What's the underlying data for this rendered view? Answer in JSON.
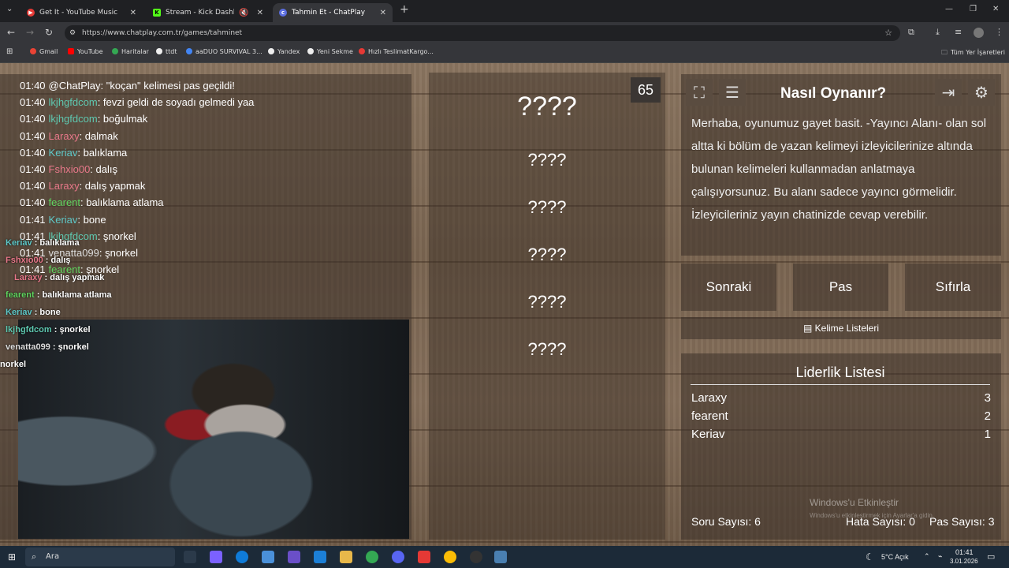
{
  "browser": {
    "tabs": [
      {
        "label": "Get It - YouTube Music",
        "color": "#e53935"
      },
      {
        "label": "Stream - Kick Dashboard",
        "color": "#53fc18"
      },
      {
        "label": "Tahmin Et - ChatPlay",
        "color": "#5b6ee1"
      }
    ],
    "url": "https://www.chatplay.com.tr/games/tahminet",
    "bookmarks": [
      "Gmail",
      "YouTube",
      "Haritalar",
      "ttdt",
      "aaDUO SURVIVAL 3...",
      "Yandex",
      "Yeni Sekme",
      "Hızlı TeslimatKargo..."
    ],
    "all_bookmarks": "Tüm Yer İşaretleri"
  },
  "chat": [
    {
      "time": "01:40",
      "user": "@ChatPlay",
      "msg": ": \"koçan\" kelimesi pas geçildi!",
      "color": "#ffffff"
    },
    {
      "time": "01:40",
      "user": "lkjhgfdcom",
      "msg": ": fevzi geldi de soyadı gelmedi yaa",
      "color": "#5ec8b0"
    },
    {
      "time": "01:40",
      "user": "lkjhgfdcom",
      "msg": ": boğulmak",
      "color": "#5ec8b0"
    },
    {
      "time": "01:40",
      "user": "Laraxy",
      "msg": ": dalmak",
      "color": "#e8788a"
    },
    {
      "time": "01:40",
      "user": "Keriav",
      "msg": ": balıklama",
      "color": "#5ec8c8"
    },
    {
      "time": "01:40",
      "user": "Fshxio00",
      "msg": ": dalış",
      "color": "#e8788a"
    },
    {
      "time": "01:40",
      "user": "Laraxy",
      "msg": ": dalış yapmak",
      "color": "#e8788a"
    },
    {
      "time": "01:40",
      "user": "fearent",
      "msg": ": balıklama atlama",
      "color": "#5fd45f"
    },
    {
      "time": "01:41",
      "user": "Keriav",
      "msg": ": bone",
      "color": "#5ec8c8"
    },
    {
      "time": "01:41",
      "user": "lkjhgfdcom",
      "msg": ": şnorkel",
      "color": "#5ec8b0"
    },
    {
      "time": "01:41",
      "user": "venatta099",
      "msg": ": şnorkel",
      "color": "#dddddd"
    },
    {
      "time": "01:41",
      "user": "fearent",
      "msg": ": şnorkel",
      "color": "#5fd45f"
    }
  ],
  "overlay": [
    {
      "user": "Keriav",
      "msg": " : balıklama",
      "color": "#5ec8c8"
    },
    {
      "user": "Fshxio00",
      "msg": " : dalış",
      "color": "#e8788a"
    },
    {
      "user": "Laraxy",
      "msg": " : dalış yapmak",
      "color": "#e8788a"
    },
    {
      "user": "fearent",
      "msg": " : balıklama atlama",
      "color": "#5fd45f"
    },
    {
      "user": "Keriav",
      "msg": " : bone",
      "color": "#5ec8c8"
    },
    {
      "user": "lkjhgfdcom",
      "msg": " : şnorkel",
      "color": "#5ec8b0"
    },
    {
      "user": "venatta099",
      "msg": " : şnorkel",
      "color": "#dddddd"
    },
    {
      "user": "",
      "msg": "norkel",
      "color": "#ffffff"
    }
  ],
  "game": {
    "timer": "65",
    "main_word": "????",
    "words": [
      "????",
      "????",
      "????",
      "????",
      "????"
    ]
  },
  "howto": {
    "title": "Nasıl Oynanır?",
    "text": "Merhaba, oyunumuz gayet basit. -Yayıncı Alanı- olan sol altta ki bölüm de yazan kelimeyi izleyicilerinize altında bulunan kelimeleri kullanmadan anlatmaya çalışıyorsunuz. Bu alanı sadece yayıncı görmelidir. İzleyicileriniz yayın chatinizde cevap verebilir."
  },
  "buttons": {
    "next": "Sonraki",
    "pass": "Pas",
    "reset": "Sıfırla",
    "word_lists": "Kelime Listeleri"
  },
  "leaderboard": {
    "title": "Liderlik Listesi",
    "rows": [
      {
        "name": "Laraxy",
        "score": "3"
      },
      {
        "name": "fearent",
        "score": "2"
      },
      {
        "name": "Keriav",
        "score": "1"
      }
    ]
  },
  "stats": {
    "questions": "Soru Sayısı: 6",
    "errors": "Hata Sayısı: 0",
    "passes": "Pas Sayısı: 3"
  },
  "windows_activation": {
    "title": "Windows'u Etkinleştir",
    "sub": "Windows'u etkinleştirmek için Ayarlar'a gidin."
  },
  "taskbar": {
    "search": "Ara",
    "weather": "5°C  Açık",
    "time": "01:41",
    "date": "3.01.2026"
  }
}
